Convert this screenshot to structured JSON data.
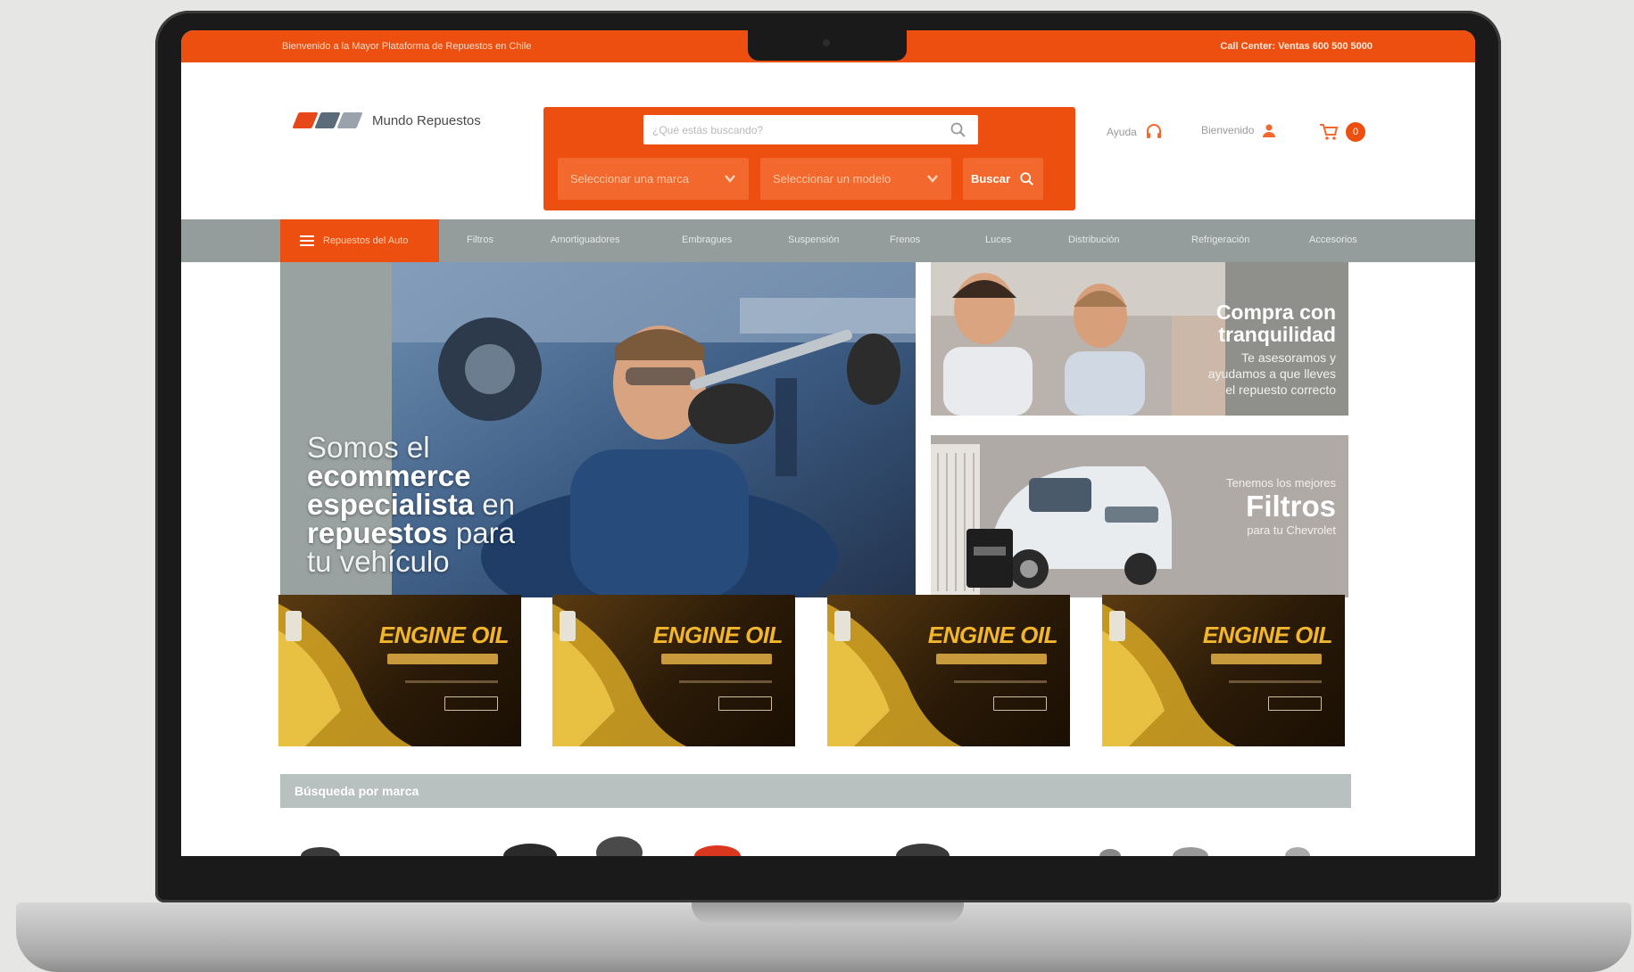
{
  "topbar": {
    "promo_text": "Bienvenido a la Mayor Plataforma de Repuestos en Chile",
    "call_center": "Call Center: Ventas 600 500 5000"
  },
  "header": {
    "logo_name": "Mundo Repuestos",
    "search_placeholder": "¿Qué estás buscando?",
    "select_marca": "Seleccionar una marca",
    "select_modelo": "Seleccionar un modelo",
    "buscar_label": "Buscar",
    "ayuda_label": "Ayuda",
    "bienvenido_label": "Bienvenido",
    "cart_count": "0"
  },
  "nav": {
    "categories_label": "Repuestos del Auto",
    "items": [
      "Filtros",
      "Amortiguadores",
      "Embragues",
      "Suspensión",
      "Frenos",
      "Luces",
      "Distribución",
      "Refrigeración",
      "Accesorios"
    ]
  },
  "hero": {
    "line1": "Somos el",
    "line2": "ecommerce",
    "line3a": "especialista",
    "line3b": " en",
    "line4a": "repuestos",
    "line4b": " para",
    "line5": "tu vehículo"
  },
  "promo_top": {
    "title_1": "Compra con",
    "title_2": "tranquilidad",
    "text": "Te asesoramos y ayudamos a que lleves el repuesto correcto"
  },
  "promo_bottom": {
    "pre": "Tenemos los mejores",
    "title": "Filtros",
    "post": "para tu Chevrolet"
  },
  "engine_oil_banners": [
    {
      "title": "ENGINE OIL"
    },
    {
      "title": "ENGINE OIL"
    },
    {
      "title": "ENGINE OIL"
    },
    {
      "title": "ENGINE OIL"
    }
  ],
  "brand_search_title": "Búsqueda por marca",
  "colors": {
    "accent": "#ec4f10",
    "nav_gray": "#949c9c",
    "oil_gold": "#f2b62c"
  }
}
